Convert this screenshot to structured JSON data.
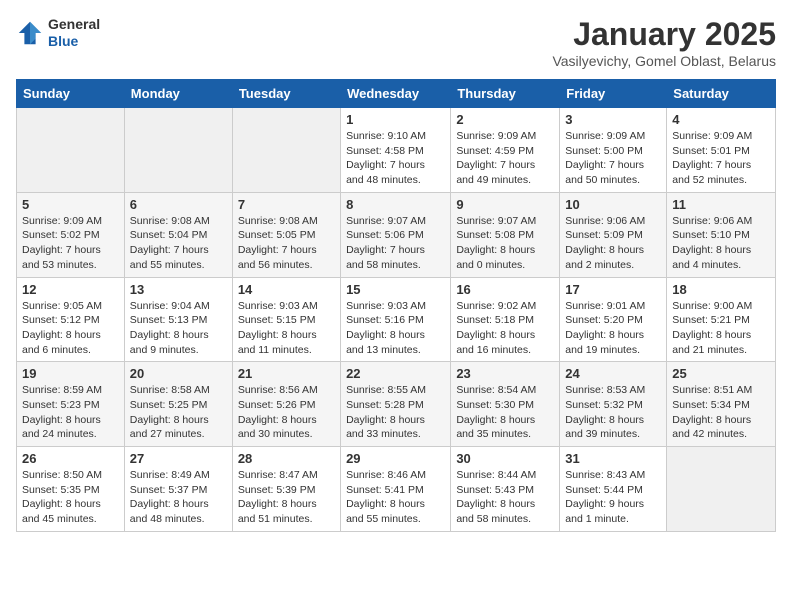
{
  "header": {
    "logo_general": "General",
    "logo_blue": "Blue",
    "title": "January 2025",
    "subtitle": "Vasilyevichy, Gomel Oblast, Belarus"
  },
  "days_of_week": [
    "Sunday",
    "Monday",
    "Tuesday",
    "Wednesday",
    "Thursday",
    "Friday",
    "Saturday"
  ],
  "weeks": [
    [
      {
        "day": "",
        "info": ""
      },
      {
        "day": "",
        "info": ""
      },
      {
        "day": "",
        "info": ""
      },
      {
        "day": "1",
        "info": "Sunrise: 9:10 AM\nSunset: 4:58 PM\nDaylight: 7 hours\nand 48 minutes."
      },
      {
        "day": "2",
        "info": "Sunrise: 9:09 AM\nSunset: 4:59 PM\nDaylight: 7 hours\nand 49 minutes."
      },
      {
        "day": "3",
        "info": "Sunrise: 9:09 AM\nSunset: 5:00 PM\nDaylight: 7 hours\nand 50 minutes."
      },
      {
        "day": "4",
        "info": "Sunrise: 9:09 AM\nSunset: 5:01 PM\nDaylight: 7 hours\nand 52 minutes."
      }
    ],
    [
      {
        "day": "5",
        "info": "Sunrise: 9:09 AM\nSunset: 5:02 PM\nDaylight: 7 hours\nand 53 minutes."
      },
      {
        "day": "6",
        "info": "Sunrise: 9:08 AM\nSunset: 5:04 PM\nDaylight: 7 hours\nand 55 minutes."
      },
      {
        "day": "7",
        "info": "Sunrise: 9:08 AM\nSunset: 5:05 PM\nDaylight: 7 hours\nand 56 minutes."
      },
      {
        "day": "8",
        "info": "Sunrise: 9:07 AM\nSunset: 5:06 PM\nDaylight: 7 hours\nand 58 minutes."
      },
      {
        "day": "9",
        "info": "Sunrise: 9:07 AM\nSunset: 5:08 PM\nDaylight: 8 hours\nand 0 minutes."
      },
      {
        "day": "10",
        "info": "Sunrise: 9:06 AM\nSunset: 5:09 PM\nDaylight: 8 hours\nand 2 minutes."
      },
      {
        "day": "11",
        "info": "Sunrise: 9:06 AM\nSunset: 5:10 PM\nDaylight: 8 hours\nand 4 minutes."
      }
    ],
    [
      {
        "day": "12",
        "info": "Sunrise: 9:05 AM\nSunset: 5:12 PM\nDaylight: 8 hours\nand 6 minutes."
      },
      {
        "day": "13",
        "info": "Sunrise: 9:04 AM\nSunset: 5:13 PM\nDaylight: 8 hours\nand 9 minutes."
      },
      {
        "day": "14",
        "info": "Sunrise: 9:03 AM\nSunset: 5:15 PM\nDaylight: 8 hours\nand 11 minutes."
      },
      {
        "day": "15",
        "info": "Sunrise: 9:03 AM\nSunset: 5:16 PM\nDaylight: 8 hours\nand 13 minutes."
      },
      {
        "day": "16",
        "info": "Sunrise: 9:02 AM\nSunset: 5:18 PM\nDaylight: 8 hours\nand 16 minutes."
      },
      {
        "day": "17",
        "info": "Sunrise: 9:01 AM\nSunset: 5:20 PM\nDaylight: 8 hours\nand 19 minutes."
      },
      {
        "day": "18",
        "info": "Sunrise: 9:00 AM\nSunset: 5:21 PM\nDaylight: 8 hours\nand 21 minutes."
      }
    ],
    [
      {
        "day": "19",
        "info": "Sunrise: 8:59 AM\nSunset: 5:23 PM\nDaylight: 8 hours\nand 24 minutes."
      },
      {
        "day": "20",
        "info": "Sunrise: 8:58 AM\nSunset: 5:25 PM\nDaylight: 8 hours\nand 27 minutes."
      },
      {
        "day": "21",
        "info": "Sunrise: 8:56 AM\nSunset: 5:26 PM\nDaylight: 8 hours\nand 30 minutes."
      },
      {
        "day": "22",
        "info": "Sunrise: 8:55 AM\nSunset: 5:28 PM\nDaylight: 8 hours\nand 33 minutes."
      },
      {
        "day": "23",
        "info": "Sunrise: 8:54 AM\nSunset: 5:30 PM\nDaylight: 8 hours\nand 35 minutes."
      },
      {
        "day": "24",
        "info": "Sunrise: 8:53 AM\nSunset: 5:32 PM\nDaylight: 8 hours\nand 39 minutes."
      },
      {
        "day": "25",
        "info": "Sunrise: 8:51 AM\nSunset: 5:34 PM\nDaylight: 8 hours\nand 42 minutes."
      }
    ],
    [
      {
        "day": "26",
        "info": "Sunrise: 8:50 AM\nSunset: 5:35 PM\nDaylight: 8 hours\nand 45 minutes."
      },
      {
        "day": "27",
        "info": "Sunrise: 8:49 AM\nSunset: 5:37 PM\nDaylight: 8 hours\nand 48 minutes."
      },
      {
        "day": "28",
        "info": "Sunrise: 8:47 AM\nSunset: 5:39 PM\nDaylight: 8 hours\nand 51 minutes."
      },
      {
        "day": "29",
        "info": "Sunrise: 8:46 AM\nSunset: 5:41 PM\nDaylight: 8 hours\nand 55 minutes."
      },
      {
        "day": "30",
        "info": "Sunrise: 8:44 AM\nSunset: 5:43 PM\nDaylight: 8 hours\nand 58 minutes."
      },
      {
        "day": "31",
        "info": "Sunrise: 8:43 AM\nSunset: 5:44 PM\nDaylight: 9 hours\nand 1 minute."
      },
      {
        "day": "",
        "info": ""
      }
    ]
  ]
}
